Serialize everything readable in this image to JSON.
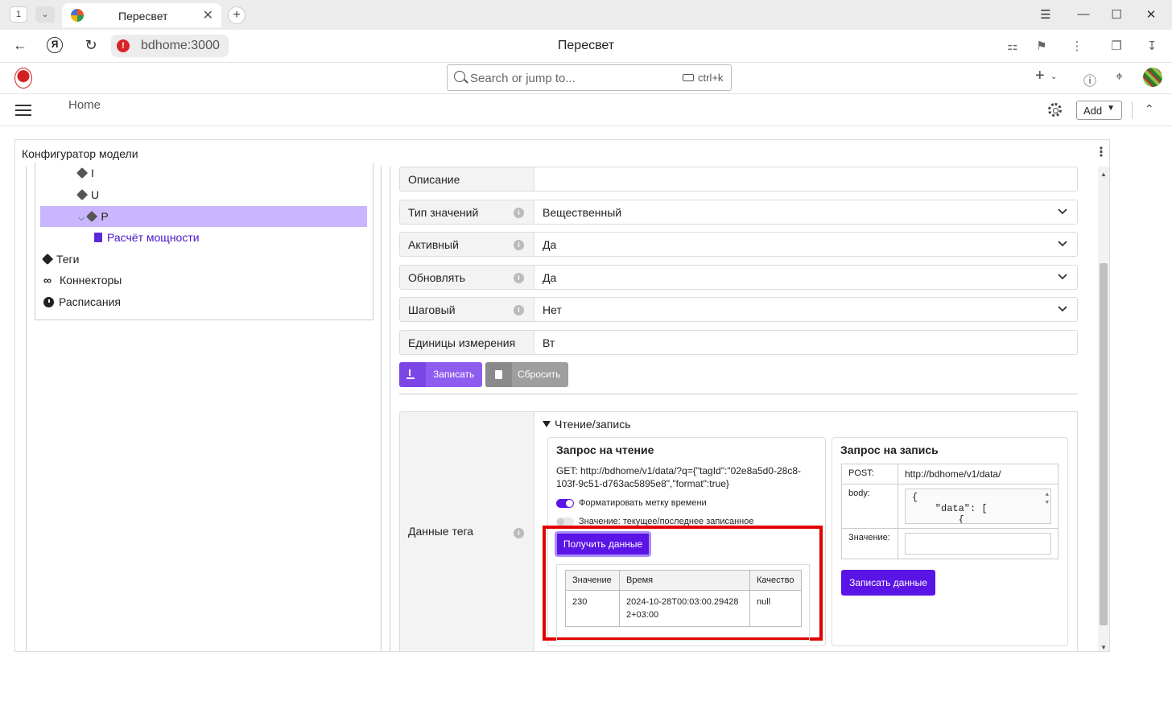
{
  "browser": {
    "tab_count": "1",
    "tab_title": "Пересвет",
    "url": "bdhome:3000",
    "page_title": "Пересвет"
  },
  "app": {
    "search_placeholder": "Search or jump to...",
    "search_shortcut": "ctrl+k",
    "breadcrumb": "Home",
    "add_label": "Add"
  },
  "panel": {
    "title": "Конфигуратор модели"
  },
  "tree": {
    "items": [
      "I",
      "U",
      "P"
    ],
    "selected_child": "Расчёт мощности",
    "tags": "Теги",
    "connectors": "Коннекторы",
    "schedules": "Расписания"
  },
  "form": {
    "rows": [
      {
        "label": "Описание",
        "value": ""
      },
      {
        "label": "Тип значений",
        "value": "Вещественный"
      },
      {
        "label": "Активный",
        "value": "Да"
      },
      {
        "label": "Обновлять",
        "value": "Да"
      },
      {
        "label": "Шаговый",
        "value": "Нет"
      },
      {
        "label": "Единицы измерения",
        "value": "Вт"
      }
    ],
    "save_label": "Записать",
    "reset_label": "Сбросить"
  },
  "tag_data": {
    "label": "Данные тега",
    "rw_toggle": "Чтение/запись",
    "read": {
      "title": "Запрос на чтение",
      "get_url": "GET:  http://bdhome/v1/data/?q={\"tagId\":\"02e8a5d0-28c8-103f-9c51-d763ac5895e8\",\"format\":true}",
      "switch_format_label": "Форматировать метку времени",
      "switch_format_on": true,
      "switch_value_label": "Значение: текущее/последнее записанное",
      "switch_value_on": false,
      "get_button": "Получить данные",
      "table": {
        "headers": [
          "Значение",
          "Время",
          "Качество"
        ],
        "rows": [
          [
            "230",
            "2024-10-28T00:03:00.294282+03:00",
            "null"
          ]
        ]
      }
    },
    "write": {
      "title": "Запрос на запись",
      "post_key": "POST:",
      "post_url": "http://bdhome/v1/data/",
      "body_key": "body:",
      "body_value": "{\n    \"data\": [\n        {",
      "value_key": "Значение:",
      "value_input": "",
      "write_button": "Записать данные"
    }
  }
}
